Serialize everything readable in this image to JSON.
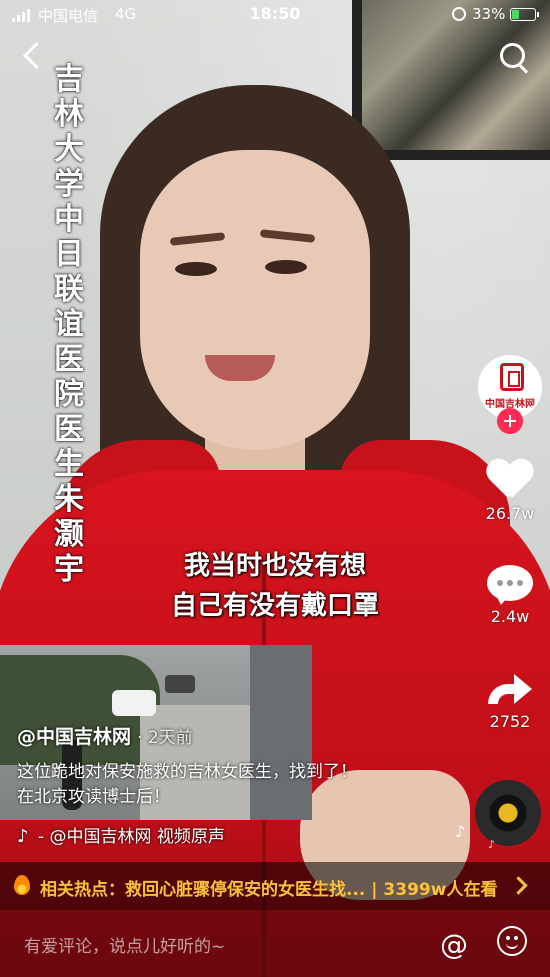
{
  "status_bar": {
    "carrier": "中国电信",
    "network": "4G",
    "time": "18:50",
    "battery_percent": "33%",
    "battery_level": 0.33,
    "battery_color": "#4cd964"
  },
  "nav": {
    "back_icon": "chevron-left-icon",
    "search_icon": "search-icon"
  },
  "video": {
    "vertical_caption": "吉林大学中日联谊医院医生朱灏宇",
    "subtitle_line1": "我当时也没有想",
    "subtitle_line2": "自己有没有戴口罩"
  },
  "rail": {
    "avatar_text": "中国吉林网",
    "likes": "26.7w",
    "comments": "2.4w",
    "shares": "2752",
    "accent": "#fe2c55"
  },
  "post": {
    "author": "@中国吉林网",
    "time": "· 2天前",
    "description_line1": "这位跪地对保安施救的吉林女医生，找到了！",
    "description_line2": "在北京攻读博士后！",
    "music": "- @中国吉林网   视频原声"
  },
  "hotbar": {
    "text": "相关热点：救回心脏骤停保安的女医生找... | 3399w人在看",
    "color": "#fcc03a"
  },
  "comment_bar": {
    "placeholder": "有爱评论，说点儿好听的~"
  }
}
